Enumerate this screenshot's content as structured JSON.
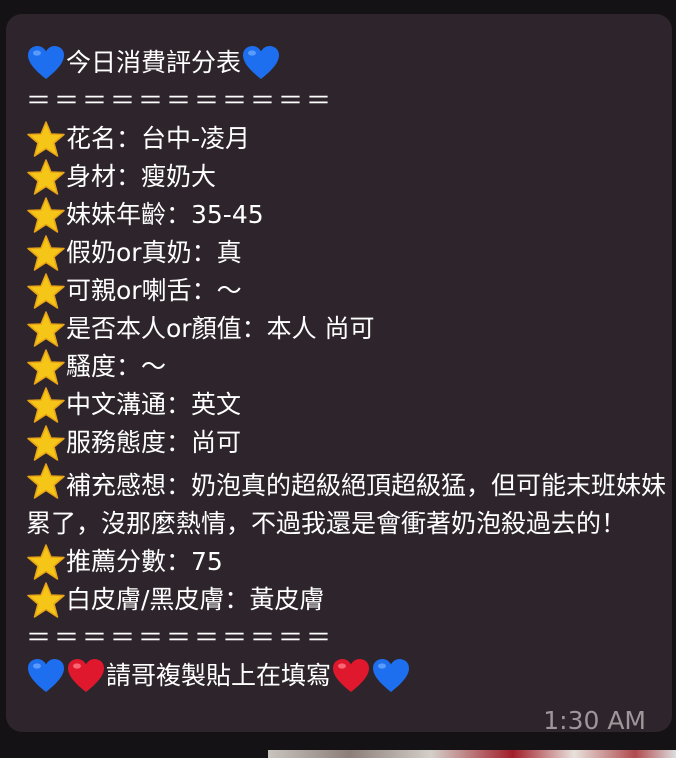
{
  "message": {
    "title": "今日消費評分表",
    "separator": "＝＝＝＝＝＝＝＝＝＝＝",
    "items": [
      "花名：台中-凌月",
      "身材：瘦奶大",
      "妹妹年齡：35-45",
      "假奶or真奶：真",
      "可親or喇舌：～",
      "是否本人or顏值：本人 尚可",
      "騷度：～",
      "中文溝通：英文",
      "服務態度：尚可"
    ],
    "feedback": "補充感想：奶泡真的超級絕頂超級猛，但可能末班妹妹累了，沒那麼熱情，不過我還是會衝著奶泡殺過去的！",
    "score": "推薦分數：75",
    "skin": "白皮膚/黑皮膚：黃皮膚",
    "separator_end": "＝＝＝＝＝＝＝＝＝＝＝",
    "footer": "請哥複製貼上在填寫",
    "time": "1:30 AM"
  },
  "icons": {
    "bullet": "star-emoji",
    "title_left": "blue-heart-emoji",
    "title_right": "blue-heart-emoji",
    "footer_left": [
      "blue-heart-emoji",
      "red-heart-emoji"
    ],
    "footer_right": [
      "red-heart-emoji",
      "blue-heart-emoji"
    ]
  },
  "colors": {
    "bubble": "#2d252b",
    "background": "#141214",
    "text": "#ffffff",
    "timestamp": "#9e969b",
    "star": "#f5c518",
    "blue_heart": "#1e6ff0",
    "red_heart": "#e0182d"
  }
}
